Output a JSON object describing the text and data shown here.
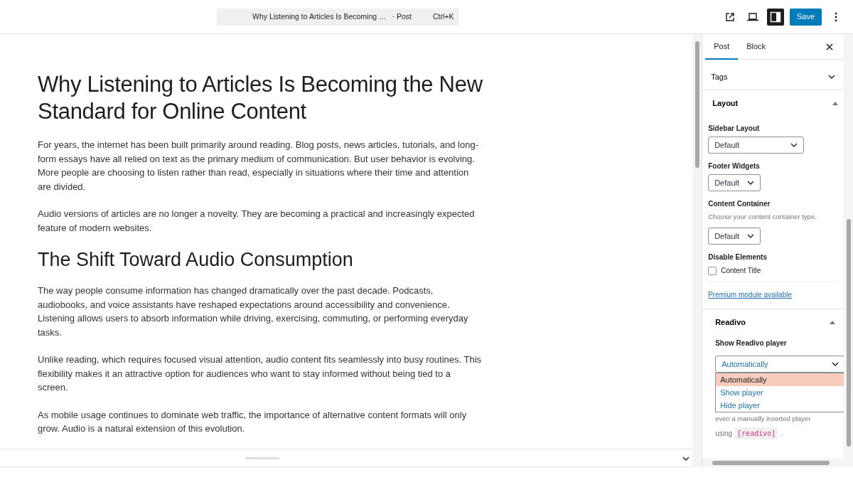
{
  "topbar": {
    "command_title": "Why Listening to Articles Is Becoming …",
    "command_type": "· Post",
    "command_shortcut": "Ctrl+K",
    "sidebar_toggle_on": true,
    "save_label": "Save"
  },
  "article": {
    "title": "Why Listening to Articles Is Becoming the New Standard for Online Content",
    "blocks": [
      {
        "kind": "paragraph",
        "text": "For years, the internet has been built primarily around reading. Blog posts, news articles, tutorials, and long-form essays have all relied on text as the primary medium of communication. But user behavior is evolving. More people are choosing to listen rather than read, especially in situations where their time and attention are divided."
      },
      {
        "kind": "paragraph",
        "text": "Audio versions of articles are no longer a novelty. They are becoming a practical and increasingly expected feature of modern websites."
      },
      {
        "kind": "heading",
        "text": "The Shift Toward Audio Consumption"
      },
      {
        "kind": "paragraph",
        "text": "The way people consume information has changed dramatically over the past decade. Podcasts, audiobooks, and voice assistants have reshaped expectations around accessibility and convenience. Listening allows users to absorb information while driving, exercising, commuting, or performing everyday tasks."
      },
      {
        "kind": "paragraph",
        "text": "Unlike reading, which requires focused visual attention, audio content fits seamlessly into busy routines. This flexibility makes it an attractive option for audiences who want to stay informed without being tied to a screen."
      },
      {
        "kind": "paragraph",
        "text": "As mobile usage continues to dominate web traffic, the importance of alternative content formats will only grow. Audio is a natural extension of this evolution."
      }
    ]
  },
  "sidebar": {
    "tabs": [
      {
        "label": "Post",
        "selected": true
      },
      {
        "label": "Block",
        "selected": false
      }
    ],
    "collapsed_panels": [
      {
        "title": "Tags",
        "expanded": false
      }
    ],
    "layout": {
      "title": "Layout",
      "expanded": true,
      "selects": [
        {
          "label": "Sidebar Layout",
          "value": "Default",
          "wide": true
        },
        {
          "label": "Footer Widgets",
          "value": "Default",
          "wide": false
        },
        {
          "label": "Content Container",
          "help": "Choose your content container type.",
          "value": "Default",
          "wide": false
        }
      ],
      "disable_label": "Disable Elements",
      "checkboxes": [
        {
          "label": "Content Title",
          "checked": false
        }
      ],
      "premium_link": "Premium module available"
    },
    "readivo": {
      "title": "Readivo",
      "expanded": true,
      "field_label": "Show Readivo player",
      "value": "Automatically",
      "options": [
        {
          "label": "Automatically",
          "selected": true
        },
        {
          "label": "Show player",
          "selected": false
        },
        {
          "label": "Hide player",
          "selected": false
        }
      ],
      "help_line": "even a manually inserted player",
      "help_prefix": "using",
      "help_code": "[readivo]",
      "help_suffix": "."
    }
  }
}
